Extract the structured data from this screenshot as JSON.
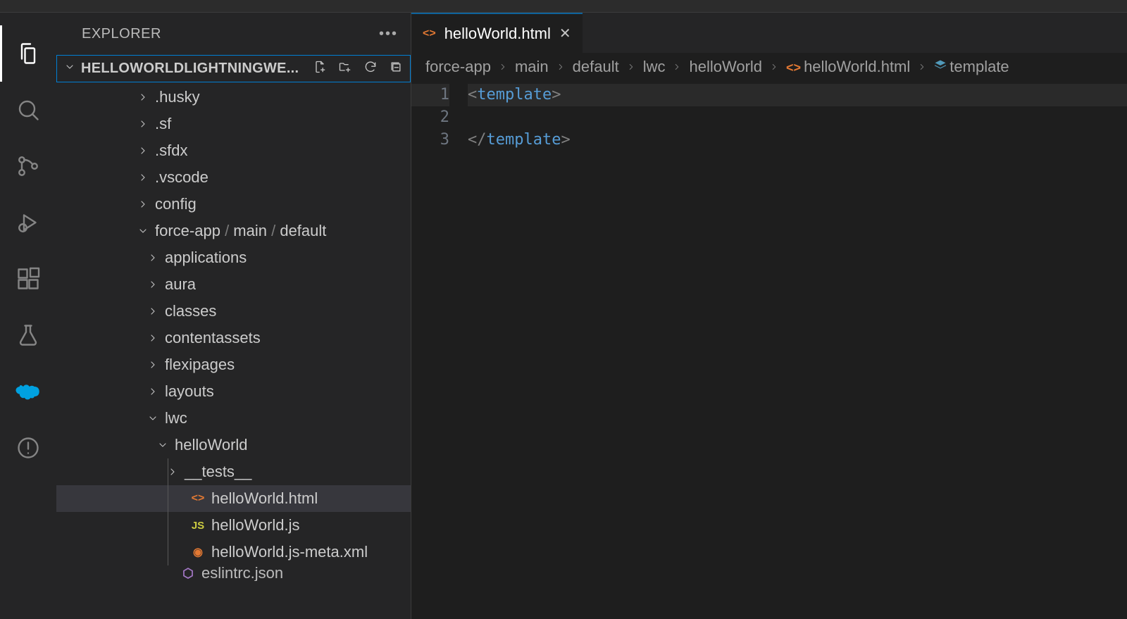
{
  "sidebar": {
    "title": "EXPLORER",
    "project_name": "HELLOWORLDLIGHTNINGWE..."
  },
  "tree": {
    "items": [
      {
        "label": ".husky",
        "type": "folder",
        "expanded": false,
        "depth": 0
      },
      {
        "label": ".sf",
        "type": "folder",
        "expanded": false,
        "depth": 0
      },
      {
        "label": ".sfdx",
        "type": "folder",
        "expanded": false,
        "depth": 0
      },
      {
        "label": ".vscode",
        "type": "folder",
        "expanded": false,
        "depth": 0
      },
      {
        "label": "config",
        "type": "folder",
        "expanded": false,
        "depth": 0
      },
      {
        "label": "force-app",
        "label2": "main",
        "label3": "default",
        "type": "folder-path",
        "expanded": true,
        "depth": 0
      },
      {
        "label": "applications",
        "type": "folder",
        "expanded": false,
        "depth": 1
      },
      {
        "label": "aura",
        "type": "folder",
        "expanded": false,
        "depth": 1
      },
      {
        "label": "classes",
        "type": "folder",
        "expanded": false,
        "depth": 1
      },
      {
        "label": "contentassets",
        "type": "folder",
        "expanded": false,
        "depth": 1
      },
      {
        "label": "flexipages",
        "type": "folder",
        "expanded": false,
        "depth": 1
      },
      {
        "label": "layouts",
        "type": "folder",
        "expanded": false,
        "depth": 1
      },
      {
        "label": "lwc",
        "type": "folder",
        "expanded": true,
        "depth": 1
      },
      {
        "label": "helloWorld",
        "type": "folder",
        "expanded": true,
        "depth": 2
      },
      {
        "label": "__tests__",
        "type": "folder",
        "expanded": false,
        "depth": 3
      },
      {
        "label": "helloWorld.html",
        "type": "file",
        "icon": "html",
        "depth": 3,
        "selected": true
      },
      {
        "label": "helloWorld.js",
        "type": "file",
        "icon": "js",
        "depth": 3
      },
      {
        "label": "helloWorld.js-meta.xml",
        "type": "file",
        "icon": "xml",
        "depth": 3
      },
      {
        "label": "eslintrc.json",
        "type": "file",
        "icon": "json",
        "depth": 2,
        "cutoff": true
      }
    ]
  },
  "tab": {
    "label": "helloWorld.html"
  },
  "breadcrumbs": {
    "segments": [
      "force-app",
      "main",
      "default",
      "lwc",
      "helloWorld",
      "helloWorld.html",
      "template"
    ]
  },
  "code": {
    "lines": [
      {
        "n": 1,
        "html": "<span class='c-punc'>&lt;</span><span class='c-tag'>template</span><span class='c-punc'>&gt;</span>",
        "hl": true
      },
      {
        "n": 2,
        "html": ""
      },
      {
        "n": 3,
        "html": "<span class='c-punc'>&lt;/</span><span class='c-tag'>template</span><span class='c-punc'>&gt;</span>"
      }
    ]
  }
}
